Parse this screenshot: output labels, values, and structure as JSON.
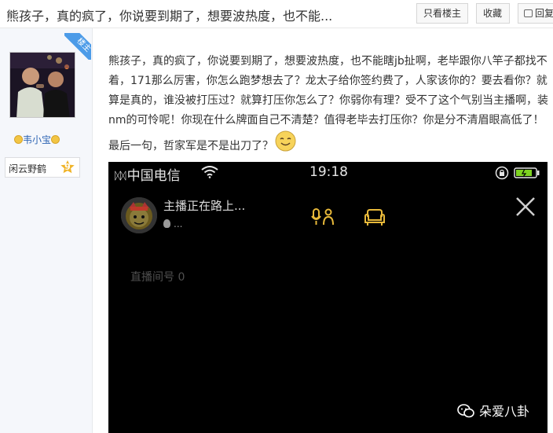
{
  "header": {
    "title": "熊孩子，真的疯了，你说要到期了，想要波热度，也不能...",
    "only_host_label": "只看楼主",
    "collect_label": "收藏",
    "reply_label": "回复"
  },
  "author": {
    "badge": "楼主",
    "name": "韦小宝",
    "level_name": "闲云野鹤",
    "level": "9"
  },
  "post": {
    "text": "熊孩子，真的疯了，你说要到期了，想要波热度，也不能瞎jb扯啊，老毕跟你八竿子都找不着，171那么厉害，你怎么跑梦想去了？龙太子给你签约费了，人家该你的？要去看你？就算是真的，谁没被打压过？就算打压你怎么了？你弱你有理？受不了这个气别当主播啊，装nm的可怜呢！你现在什么牌面自己不清楚？值得老毕去打压你？你是分不清眉眼高低了！最后一句，哲家军是不是出刀了？"
  },
  "screenshot": {
    "signal": "ᛞᛞ",
    "carrier": "中国电信",
    "time": "19:18",
    "host_status": "主播正在路上...",
    "host_sub": "...",
    "room_label": "直播间号 0",
    "watermark": "朵爱八卦"
  },
  "colors": {
    "accent_link": "#2d64b3",
    "host_badge": "#4c9be8",
    "level_badge": "#f0b429",
    "battery_green": "#7ed321",
    "icon_gold": "#e8b93a"
  }
}
